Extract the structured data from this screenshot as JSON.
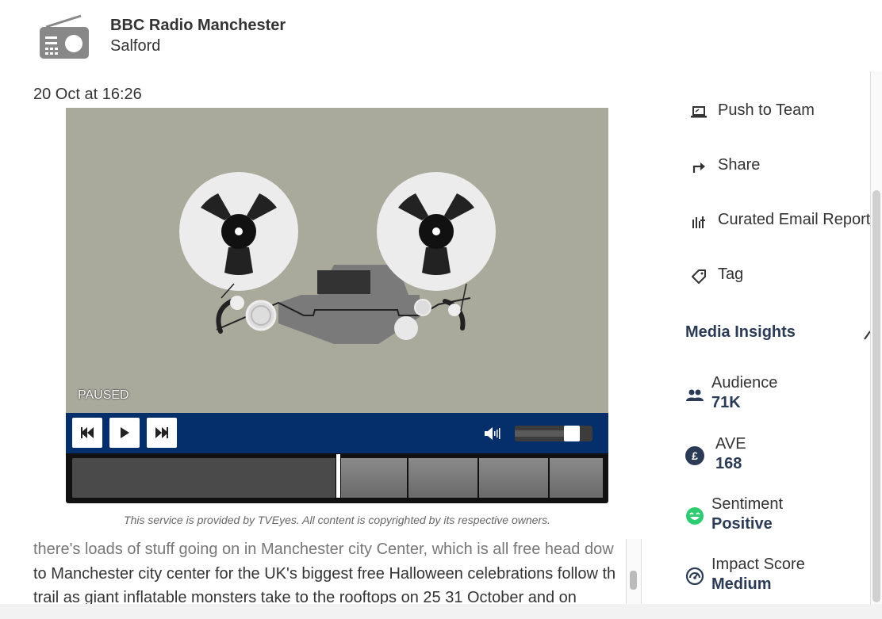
{
  "header": {
    "station_name": "BBC Radio Manchester",
    "location": "Salford",
    "icon": "radio-icon"
  },
  "timestamp": "20 Oct at 16:26",
  "player": {
    "status": "PAUSED",
    "volume_level": 0.8,
    "controls": [
      "rewind-icon",
      "play-icon",
      "fast-forward-icon",
      "volume-icon"
    ],
    "screen_color": "#a9a99c",
    "control_bar_color": "#052f6a"
  },
  "disclaimer": "This service is provided by TVEyes. All content is copyrighted by its respective owners.",
  "transcript": {
    "lines": [
      "there's loads of stuff going on in Manchester city Center, which is all free head dow",
      "to Manchester city center for the UK's biggest free Halloween celebrations follow th",
      "trail as giant inflatable monsters take to the rooftops on 25 31 October and on"
    ]
  },
  "actions": [
    {
      "label": "Push to Team",
      "icon": "laptop-icon"
    },
    {
      "label": "Share",
      "icon": "share-arrow-icon"
    },
    {
      "label": "Curated Email Report",
      "icon": "report-chart-icon"
    },
    {
      "label": "Tag",
      "icon": "tag-icon"
    }
  ],
  "insights": {
    "title": "Media Insights",
    "metrics": [
      {
        "label": "Audience",
        "value": "71K",
        "icon": "people-icon",
        "color": "#2b3a55"
      },
      {
        "label": "AVE",
        "value": "168",
        "icon": "pound-icon",
        "color": "#2b3a55"
      },
      {
        "label": "Sentiment",
        "value": "Positive",
        "icon": "smiley-icon",
        "color": "#2ecc71"
      },
      {
        "label": "Impact Score",
        "value": "Medium",
        "icon": "gauge-icon",
        "color": "#2b3a55"
      }
    ]
  }
}
